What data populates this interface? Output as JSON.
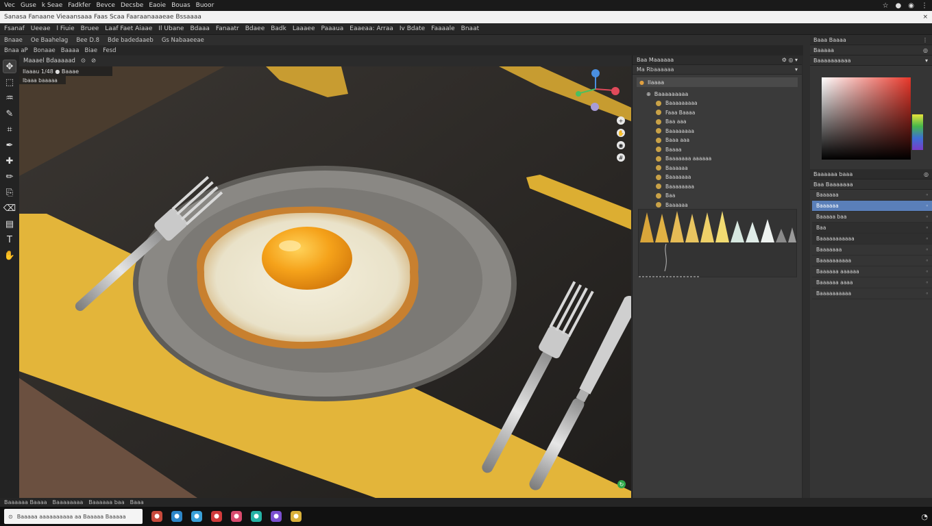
{
  "titlebar": {
    "menu": [
      "Vec",
      "Guse",
      "k Seae",
      "Fadkfer",
      "Bevce",
      "Decsbe",
      "Eaoie",
      "Bouas",
      "Buoor"
    ],
    "sys": [
      "☆",
      "●",
      "◉",
      "⋮"
    ]
  },
  "addressbar": {
    "url": "Sanasa Fanaane Vieaansaaa Faas Scaa Faaraanaaaeae Bssaaaa",
    "right": "×"
  },
  "menubar": {
    "items": [
      "Fsanaf",
      "Ueeae",
      "l Fiuie",
      "Bruee",
      "Laaf Faet Aiaae",
      "Il Ubane",
      "Bdaaa",
      "Fanaatr",
      "Bdaee",
      "Badk",
      "Laaaee",
      "Paaaua",
      "Eaaeaa: Arraa",
      "Iv Bdate",
      "Faaaale",
      "Bnaat"
    ]
  },
  "optionsbar": {
    "items": [
      "Bnaae",
      "Oe Baahelag",
      "Bee D.8",
      "Bde badedaaeb",
      "Gs Nabaaeeae"
    ]
  },
  "tabbar": {
    "items": [
      "Bnaa aP",
      "Bonaae",
      "Baaaa",
      "Biae",
      "Fesd"
    ]
  },
  "toolbar": {
    "tools": [
      {
        "name": "move-tool",
        "glyph": "✥"
      },
      {
        "name": "marquee-tool",
        "glyph": "⬚"
      },
      {
        "name": "lasso-tool",
        "glyph": "♒"
      },
      {
        "name": "quick-select-tool",
        "glyph": "✎"
      },
      {
        "name": "crop-tool",
        "glyph": "⌗"
      },
      {
        "name": "eyedropper-tool",
        "glyph": "✒"
      },
      {
        "name": "healing-tool",
        "glyph": "✚"
      },
      {
        "name": "brush-tool",
        "glyph": "✏"
      },
      {
        "name": "stamp-tool",
        "glyph": "⎘"
      },
      {
        "name": "eraser-tool",
        "glyph": "⌫"
      },
      {
        "name": "gradient-tool",
        "glyph": "▤"
      },
      {
        "name": "type-tool",
        "glyph": "T"
      },
      {
        "name": "hand-tool",
        "glyph": "✋"
      }
    ]
  },
  "canvas": {
    "header": [
      "Maaael Bdaaaaad",
      "⊙",
      "⊘"
    ],
    "doc_info": "Ilaaau 1/48 ● Baaae",
    "doc_sub": "Ibaaa baaaaa"
  },
  "layers_panel": {
    "title": "Baa Maaaaaa",
    "tab": "Ma Rbaaaaaa",
    "root": "Ilaaaa",
    "group": "Baaaaaaaaa",
    "items": [
      "Baaaaaaaaa",
      "Faaa Baaaa",
      "Baa aaa",
      "Baaaaaaaa",
      "Baaa aaa",
      "Baaaa",
      "Baaaaaaa aaaaaa",
      "Baaaaaa",
      "Baaaaaaa",
      "Baaaaaaaa",
      "Baa",
      "Baaaaaa"
    ]
  },
  "color_panel": {
    "title": "Baaa Baaaa",
    "sub1": "Baaaaa",
    "sub2": "Baaaaaaaaaa"
  },
  "properties_panel": {
    "title": "Baaaaaa baaa",
    "sub": "Baa Baaaaaaa",
    "rows": [
      "Baaaaaa",
      "Baaaaaa",
      "Baaaaa baa",
      "Baa",
      "Baaaaaaaaaaa",
      "Baaaaaaa",
      "Baaaaaaaaaa",
      "Baaaaaa aaaaaa",
      "Baaaaaa aaaa",
      "Baaaaaaaaaa"
    ]
  },
  "statusbar": {
    "items": [
      "Baaaaaa Baaaa",
      "Baaaaaaaa",
      "Baaaaaa baa",
      "Baaa"
    ]
  },
  "taskbar": {
    "search": "Baaaaa aaaaaaaaaa aa Baaaaa Baaaaa",
    "apps": [
      {
        "name": "app-red",
        "color": "#c84a3c"
      },
      {
        "name": "app-blue",
        "color": "#2d86c8"
      },
      {
        "name": "app-lightblue",
        "color": "#3aa0d8"
      },
      {
        "name": "app-crimson",
        "color": "#d13b3b"
      },
      {
        "name": "app-pink",
        "color": "#d94b6f"
      },
      {
        "name": "app-teal",
        "color": "#25b3a5"
      },
      {
        "name": "app-purple",
        "color": "#7b4fd0"
      },
      {
        "name": "app-yellow",
        "color": "#d9b03a"
      }
    ]
  }
}
